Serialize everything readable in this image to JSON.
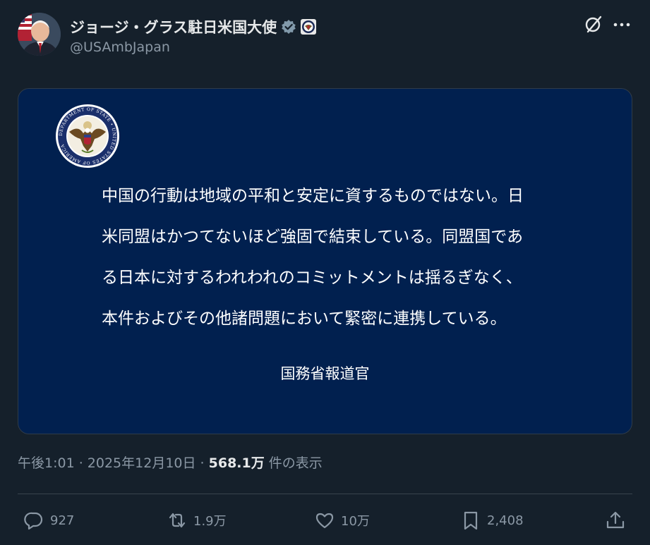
{
  "post": {
    "display_name": "ジョージ・グラス駐日米国大使",
    "handle": "@USAmbJapan"
  },
  "statement": {
    "lines": [
      "中国の行動は地域の平和と安定に資するものではない。日",
      "米同盟はかつてないほど強固で結束している。同盟国であ",
      "る日本に対するわれわれのコミットメントは揺るぎなく、",
      "本件およびその他諸問題において緊密に連携している。"
    ],
    "signature": "国務省報道官",
    "seal_text": "DEPARTMENT OF STATE • UNITED STATES OF AMERICA"
  },
  "meta": {
    "time": "午後1:01",
    "sep1": " · ",
    "date": "2025年12月10日",
    "sep2": " · ",
    "views_count": "568.1万",
    "views_label": " 件の表示"
  },
  "actions": {
    "reply_count": "927",
    "repost_count": "1.9万",
    "like_count": "10万",
    "bookmark_count": "2,408"
  },
  "colors": {
    "background": "#15202b",
    "card_background": "#01204f",
    "secondary_text": "#8b98a5",
    "verified_badge": "#829aab"
  },
  "icons": [
    "verified-badge-icon",
    "grok-icon",
    "more-icon",
    "reply-icon",
    "repost-icon",
    "like-icon",
    "bookmark-icon",
    "share-icon"
  ]
}
